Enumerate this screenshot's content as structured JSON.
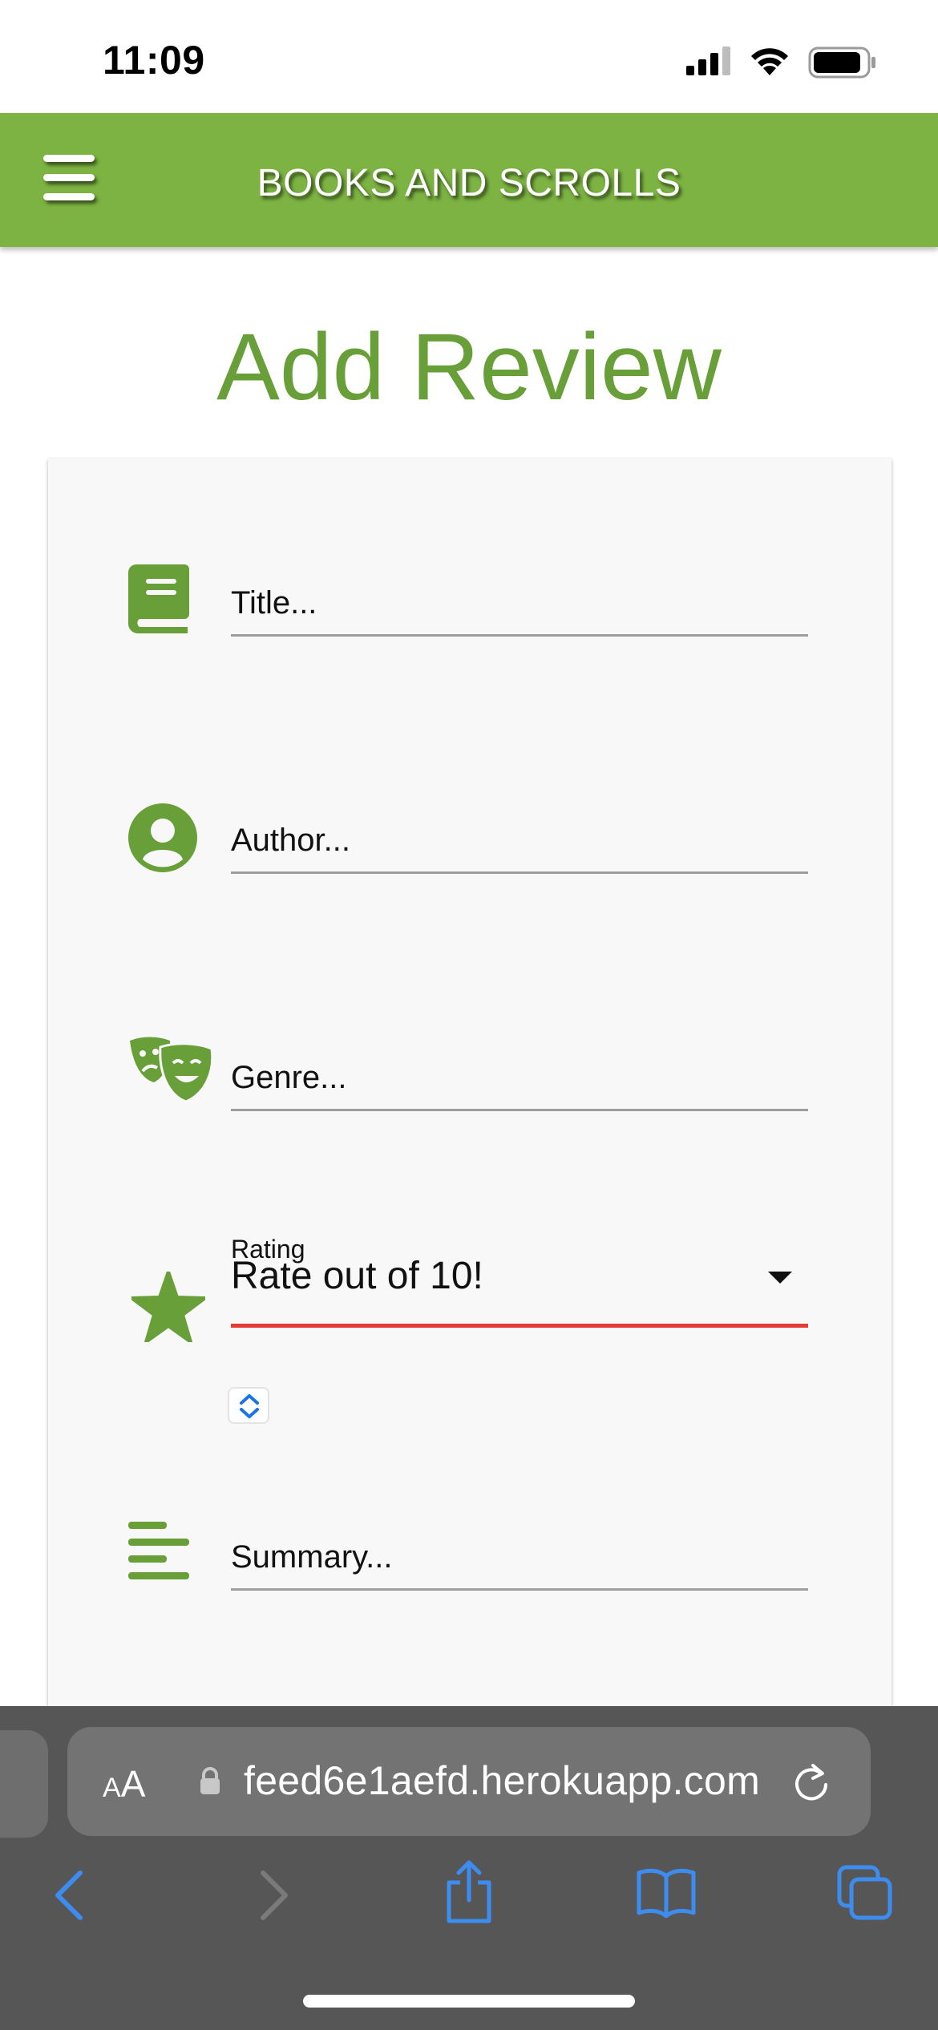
{
  "status_bar": {
    "time": "11:09"
  },
  "navbar": {
    "brand": "BOOKS AND SCROLLS",
    "menu_icon": "hamburger-menu-icon"
  },
  "page": {
    "title": "Add Review"
  },
  "form": {
    "title_field": {
      "placeholder": "Title...",
      "icon": "book-icon"
    },
    "author_field": {
      "placeholder": "Author...",
      "icon": "user-circle-icon"
    },
    "genre_field": {
      "placeholder": "Genre...",
      "icon": "theater-masks-icon"
    },
    "rating_field": {
      "label": "Rating",
      "value": "Rate out of 10!",
      "icon": "star-icon"
    },
    "summary_field": {
      "placeholder": "Summary...",
      "icon": "align-left-icon"
    }
  },
  "browser": {
    "text_size_label_small": "A",
    "text_size_label_big": "A",
    "url": "feed6e1aefd.herokuapp.com"
  },
  "colors": {
    "brand_green": "#7cb342",
    "title_green": "#689f38",
    "error_red": "#e53935",
    "ios_blue": "#3d8cf0"
  }
}
